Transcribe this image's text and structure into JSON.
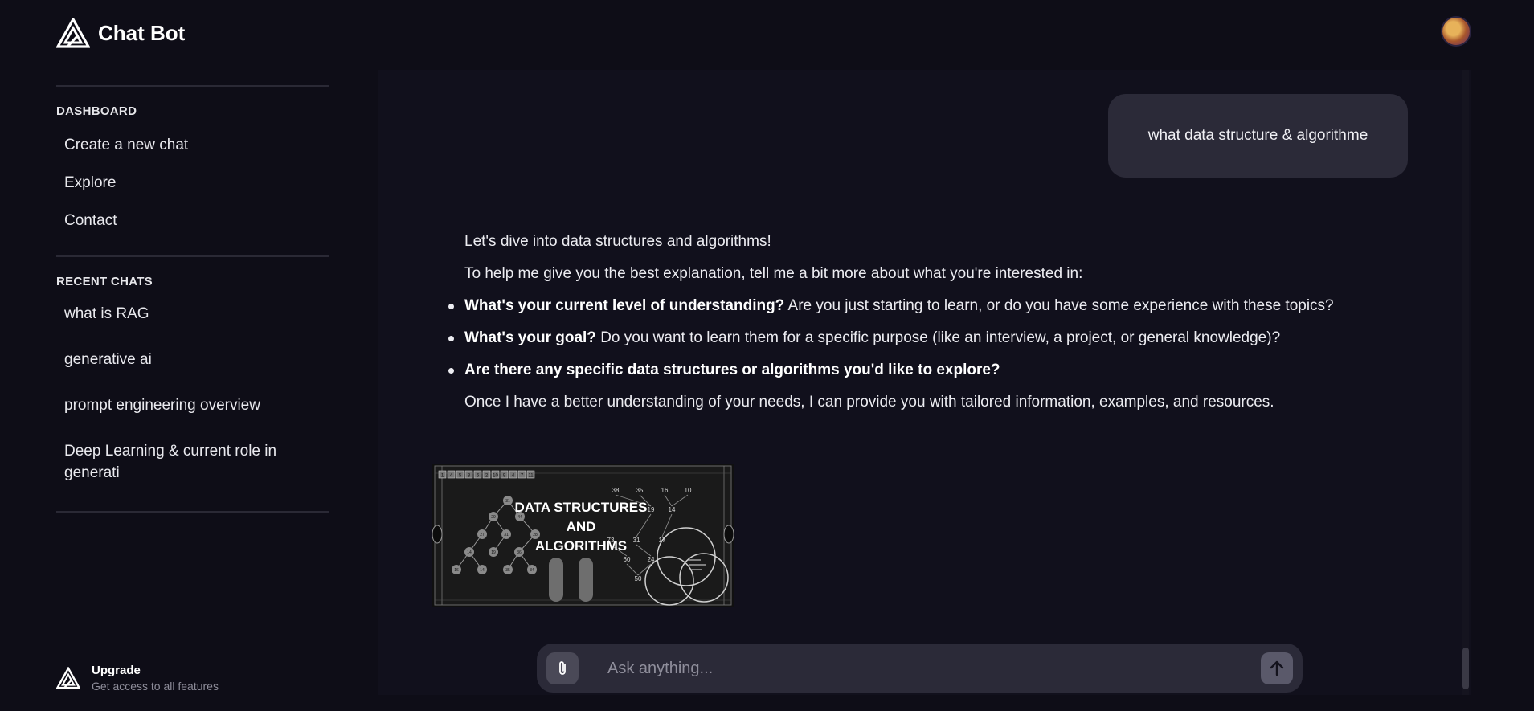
{
  "app": {
    "name": "Chat Bot"
  },
  "sidebar": {
    "dashboard_title": "DASHBOARD",
    "dashboard_items": [
      {
        "label": "Create a new chat"
      },
      {
        "label": "Explore"
      },
      {
        "label": "Contact"
      }
    ],
    "recent_title": "RECENT CHATS",
    "recent_items": [
      {
        "label": "what is RAG"
      },
      {
        "label": "generative ai"
      },
      {
        "label": "prompt engineering overview"
      },
      {
        "label": "Deep Learning & current role in generati"
      }
    ],
    "upgrade": {
      "title": "Upgrade",
      "subtitle": "Get access to all features"
    }
  },
  "conversation": {
    "user_message": "what data structure & algorithme",
    "assistant": {
      "intro": "Let's dive into data structures and algorithms!",
      "prompt": "To help me give you the best explanation, tell me a bit more about what you're interested in:",
      "bullets": [
        {
          "bold": "What's your current level of understanding?",
          "text": " Are you just starting to learn, or do you have some experience with these topics?"
        },
        {
          "bold": "What's your goal?",
          "text": " Do you want to learn them for a specific purpose (like an interview, a project, or general knowledge)?"
        },
        {
          "bold": "Are there any specific data structures or algorithms you'd like to explore?",
          "text": ""
        }
      ],
      "closing": "Once I have a better understanding of your needs, I can provide you with tailored information, examples, and resources.",
      "image": {
        "title_lines": [
          "DATA STRUCTURES",
          "AND",
          "ALGORITHMS"
        ],
        "array_values": [
          "1",
          "4",
          "5",
          "3",
          "6",
          "2",
          "10",
          "9",
          "4",
          "7",
          "11"
        ],
        "tree_top_values": [
          "38",
          "35",
          "16",
          "10",
          "19",
          "14",
          "73",
          "31",
          "17",
          "60",
          "24",
          "50"
        ],
        "tree_left_values": [
          "31",
          "29",
          "44",
          "27",
          "31",
          "28",
          "14",
          "19",
          "36",
          "16",
          "14",
          "35",
          "34"
        ]
      }
    }
  },
  "composer": {
    "placeholder": "Ask anything..."
  },
  "icons": {
    "attach": "paperclip-icon",
    "send": "arrow-up-icon",
    "logo": "triangle-logo-icon"
  }
}
